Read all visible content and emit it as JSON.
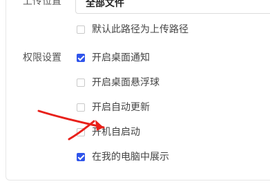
{
  "upload": {
    "label": "上传位置",
    "selected_value": "全部文件"
  },
  "default_path": {
    "label": "默认此路径为上传路径",
    "checked": false
  },
  "permissions": {
    "label": "权限设置",
    "options": [
      {
        "label": "开启桌面通知",
        "checked": true
      },
      {
        "label": "开启桌面悬浮球",
        "checked": false
      },
      {
        "label": "开启自动更新",
        "checked": false
      },
      {
        "label": "开机自启动",
        "checked": false
      },
      {
        "label": "在我的电脑中展示",
        "checked": true
      }
    ]
  },
  "colors": {
    "accent": "#2f54eb",
    "annotation_arrow": "#e8201a"
  }
}
